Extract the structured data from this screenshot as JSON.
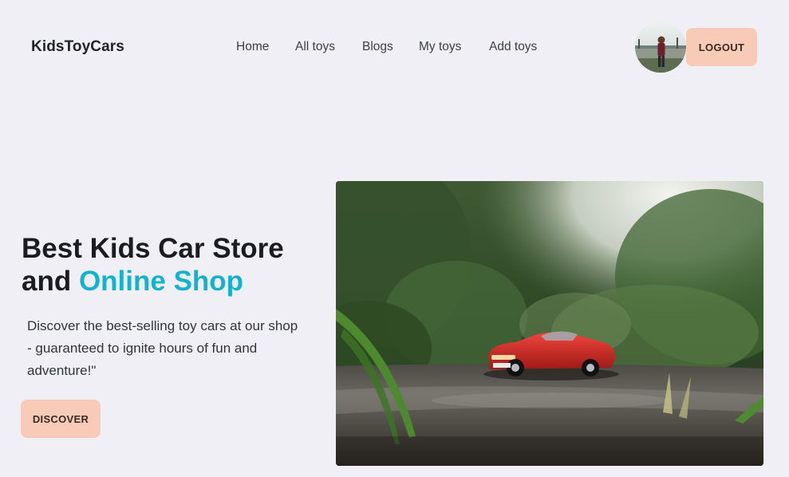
{
  "header": {
    "brand": "KidsToyCars",
    "nav": [
      {
        "label": "Home"
      },
      {
        "label": "All toys"
      },
      {
        "label": "Blogs"
      },
      {
        "label": "My toys"
      },
      {
        "label": "Add toys"
      }
    ],
    "logout_label": "LOGOUT"
  },
  "hero": {
    "title_line1": "Best Kids Car Store",
    "title_line2_prefix": "and ",
    "title_line2_accent": "Online Shop",
    "description": "Discover the best-selling toy cars at our shop - guaranteed to ignite hours of fun and adventure!\"",
    "discover_label": "DISCOVER"
  },
  "colors": {
    "background": "#f0eff6",
    "accent": "#13b3d0",
    "button": "#f8cbb9"
  }
}
